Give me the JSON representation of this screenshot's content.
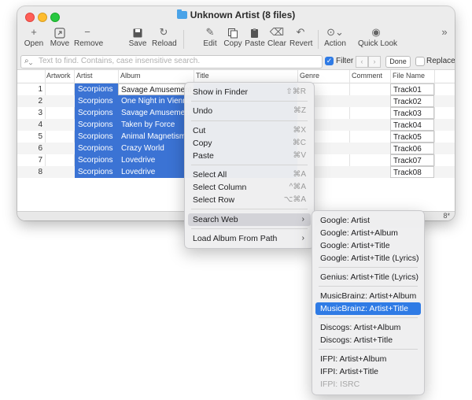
{
  "window": {
    "title": "Unknown Artist (8 files)"
  },
  "toolbar": {
    "open": "Open",
    "move": "Move",
    "remove": "Remove",
    "save": "Save",
    "reload": "Reload",
    "edit": "Edit",
    "copy": "Copy",
    "paste": "Paste",
    "clear": "Clear",
    "revert": "Revert",
    "action": "Action",
    "quicklook": "Quick Look"
  },
  "search": {
    "placeholder": "Text to find. Contains, case insensitive search.",
    "filter_label": "Filter",
    "done_label": "Done",
    "replace_label": "Replace"
  },
  "table": {
    "headers": {
      "artwork": "Artwork",
      "artist": "Artist",
      "album": "Album",
      "title": "Title",
      "genre": "Genre",
      "comment": "Comment",
      "filename": "File Name"
    },
    "rows": [
      {
        "num": "1",
        "artist": "Scorpions",
        "album": "Savage Amusement",
        "file": "Track01"
      },
      {
        "num": "2",
        "artist": "Scorpions",
        "album": "One Night in Vienna",
        "file": "Track02"
      },
      {
        "num": "3",
        "artist": "Scorpions",
        "album": "Savage Amusement",
        "file": "Track03"
      },
      {
        "num": "4",
        "artist": "Scorpions",
        "album": "Taken by Force",
        "file": "Track04"
      },
      {
        "num": "5",
        "artist": "Scorpions",
        "album": "Animal Magnetism",
        "file": "Track05"
      },
      {
        "num": "6",
        "artist": "Scorpions",
        "album": "Crazy World",
        "file": "Track06"
      },
      {
        "num": "7",
        "artist": "Scorpions",
        "album": "Lovedrive",
        "file": "Track07"
      },
      {
        "num": "8",
        "artist": "Scorpions",
        "album": "Lovedrive",
        "file": "Track08"
      }
    ]
  },
  "status": {
    "count": "8*"
  },
  "context_menu": {
    "show_in_finder": "Show in Finder",
    "show_in_finder_sc": "⇧⌘R",
    "undo": "Undo",
    "undo_sc": "⌘Z",
    "cut": "Cut",
    "cut_sc": "⌘X",
    "copy": "Copy",
    "copy_sc": "⌘C",
    "paste": "Paste",
    "paste_sc": "⌘V",
    "select_all": "Select All",
    "select_all_sc": "⌘A",
    "select_column": "Select Column",
    "select_column_sc": "^⌘A",
    "select_row": "Select Row",
    "select_row_sc": "⌥⌘A",
    "search_web": "Search Web",
    "load_album": "Load Album From Path"
  },
  "submenu": {
    "google_artist": "Google: Artist",
    "google_artist_album": "Google: Artist+Album",
    "google_artist_title": "Google: Artist+Title",
    "google_artist_title_lyrics": "Google: Artist+Title (Lyrics)",
    "genius": "Genius: Artist+Title (Lyrics)",
    "musicbrainz_album": "MusicBrainz: Artist+Album",
    "musicbrainz_title": "MusicBrainz: Artist+Title",
    "discogs_album": "Discogs: Artist+Album",
    "discogs_title": "Discogs: Artist+Title",
    "ifpi_album": "IFPI: Artist+Album",
    "ifpi_title": "IFPI: Artist+Title",
    "ifpi_isrc": "IFPI: ISRC"
  },
  "colors": {
    "selection": "#3b73d4",
    "menu_highlight": "#2f7be5"
  }
}
